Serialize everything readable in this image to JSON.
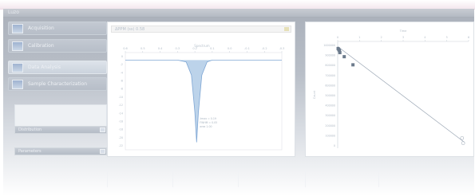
{
  "window": {
    "title": "Luzo"
  },
  "sidebar": {
    "items": [
      {
        "label": "Acquisition",
        "icon": "instrument-icon",
        "selected": false
      },
      {
        "label": "Calibration",
        "icon": "calibration-icon",
        "selected": false
      },
      {
        "label": "Data Analysis",
        "icon": "chart-icon",
        "selected": true
      },
      {
        "label": "Sample Characterization",
        "icon": "sample-icon",
        "selected": false
      }
    ],
    "combo1_label": "Distribution",
    "combo2_label": "Parameters",
    "footer": ""
  },
  "center": {
    "field_value": "ΔPPM (ss)  0.58",
    "chart_title": "Spectrum",
    "x_ticks": [
      "0.6",
      "0.5",
      "0.4",
      "0.3",
      "0.2",
      "0.1",
      "0.0",
      "-0.1",
      "-0.2",
      "-0.3"
    ],
    "y_ticks": [
      "0",
      "-2",
      "-4",
      "-6",
      "-8",
      "-10",
      "-12",
      "-14",
      "-16",
      "-18",
      "-20",
      "-22"
    ],
    "annotations": [
      "λmax = 0.19",
      "FWHM = 0.05",
      "area 1.00"
    ]
  },
  "right": {
    "x_axis_label": "Time",
    "y_axis_label": "Count",
    "x_ticks": [
      "0",
      "1",
      "2",
      "3",
      "4",
      "5",
      "6"
    ],
    "y_ticks": [
      "1000000",
      "900000",
      "800000",
      "700000",
      "600000",
      "500000",
      "400000",
      "300000",
      "200000",
      "100000",
      "0"
    ]
  },
  "chart_data": [
    {
      "type": "line",
      "title": "Spectrum",
      "x": [
        0.6,
        0.5,
        0.4,
        0.35,
        0.3,
        0.25,
        0.22,
        0.2,
        0.19,
        0.18,
        0.16,
        0.13,
        0.1,
        0.0,
        -0.1,
        -0.2,
        -0.3
      ],
      "y": [
        0,
        0,
        0,
        0,
        0,
        -0.5,
        -4,
        -14,
        -22,
        -14,
        -4,
        -0.5,
        0,
        0,
        0,
        0,
        0
      ],
      "xlim": [
        0.6,
        -0.3
      ],
      "ylim": [
        -24,
        2
      ],
      "color": "#7ea6d4"
    },
    {
      "type": "scatter",
      "x": [
        0.02,
        0.05,
        0.08,
        0.1,
        0.3,
        0.7,
        5.7,
        5.75
      ],
      "y": [
        980000,
        970000,
        960000,
        940000,
        900000,
        820000,
        100000,
        50000
      ],
      "xlim": [
        0,
        6
      ],
      "ylim": [
        0,
        1050000
      ],
      "trend": {
        "x": [
          0,
          5.8
        ],
        "y": [
          1000000,
          60000
        ]
      },
      "color": "#6c7b8c"
    }
  ],
  "status": {
    "left": "",
    "right": ""
  }
}
